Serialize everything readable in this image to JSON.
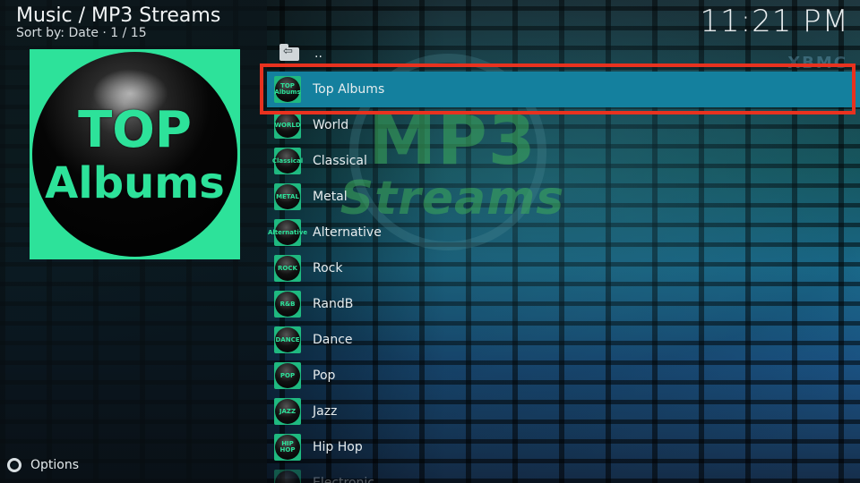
{
  "header": {
    "title": "Music / MP3 Streams",
    "subtitle": "Sort by: Date  ·  1 / 15",
    "clock": "11:21 PM"
  },
  "thumbnail": {
    "line1": "TOP",
    "line2": "Albums"
  },
  "watermark": {
    "line1": "MP3",
    "line2": "Streams",
    "corner": "XBMC"
  },
  "footer": {
    "options_label": "Options"
  },
  "list": {
    "parent_label": "..",
    "items": [
      {
        "label": "Top Albums",
        "icon_text": "TOP Albums",
        "selected": true
      },
      {
        "label": "World",
        "icon_text": "WORLD"
      },
      {
        "label": "Classical",
        "icon_text": "Classical"
      },
      {
        "label": "Metal",
        "icon_text": "METAL"
      },
      {
        "label": "Alternative",
        "icon_text": "Alternative"
      },
      {
        "label": "Rock",
        "icon_text": "ROCK"
      },
      {
        "label": "RandB",
        "icon_text": "R&B"
      },
      {
        "label": "Dance",
        "icon_text": "DANCE"
      },
      {
        "label": "Pop",
        "icon_text": "POP"
      },
      {
        "label": "Jazz",
        "icon_text": "JAZZ"
      },
      {
        "label": "Hip Hop",
        "icon_text": "HIP HOP"
      },
      {
        "label": "Electronic",
        "icon_text": ""
      }
    ]
  },
  "colors": {
    "accent_green": "#2de29a",
    "selected_row": "#14809e",
    "highlight_border": "#e8321f"
  }
}
